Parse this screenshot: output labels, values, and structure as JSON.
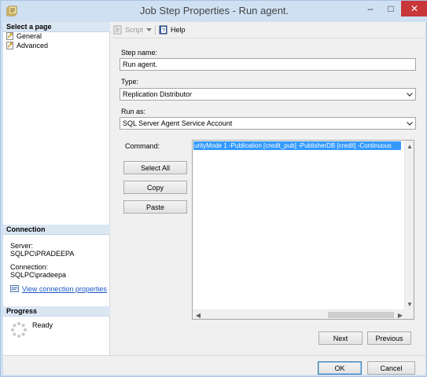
{
  "window": {
    "title": "Job Step Properties - Run agent.",
    "controls": {
      "minimize": "–",
      "maximize": "□",
      "close": "✕"
    }
  },
  "left_pane": {
    "select_page_header": "Select a page",
    "pages": [
      {
        "label": "General",
        "icon": "wrench-page-icon"
      },
      {
        "label": "Advanced",
        "icon": "wrench-page-icon"
      }
    ],
    "connection_header": "Connection",
    "server_label": "Server:",
    "server_value": "SQLPC\\PRADEEPA",
    "connection_label": "Connection:",
    "connection_value": "SQLPC\\pradeepa",
    "view_connection_link": "View connection properties",
    "progress_header": "Progress",
    "progress_status": "Ready"
  },
  "toolbar": {
    "script_label": "Script",
    "help_label": "Help"
  },
  "form": {
    "step_name_label": "Step name:",
    "step_name_value": "Run agent.",
    "type_label": "Type:",
    "type_value": "Replication Distributor",
    "run_as_label": "Run as:",
    "run_as_value": "SQL Server Agent Service Account",
    "command_label": "Command:",
    "command_value": "urityMode 1 -Publication [credit_pub] -PublisherDB [credit]     -Continuous",
    "select_all_label": "Select All",
    "copy_label": "Copy",
    "paste_label": "Paste",
    "next_label": "Next",
    "previous_label": "Previous"
  },
  "footer": {
    "ok_label": "OK",
    "cancel_label": "Cancel"
  },
  "colors": {
    "title_bar": "#cfe0f3",
    "close_button": "#c7373a",
    "selection": "#3399ff",
    "link": "#1a56c6",
    "section_header": "#dbe6f3"
  }
}
